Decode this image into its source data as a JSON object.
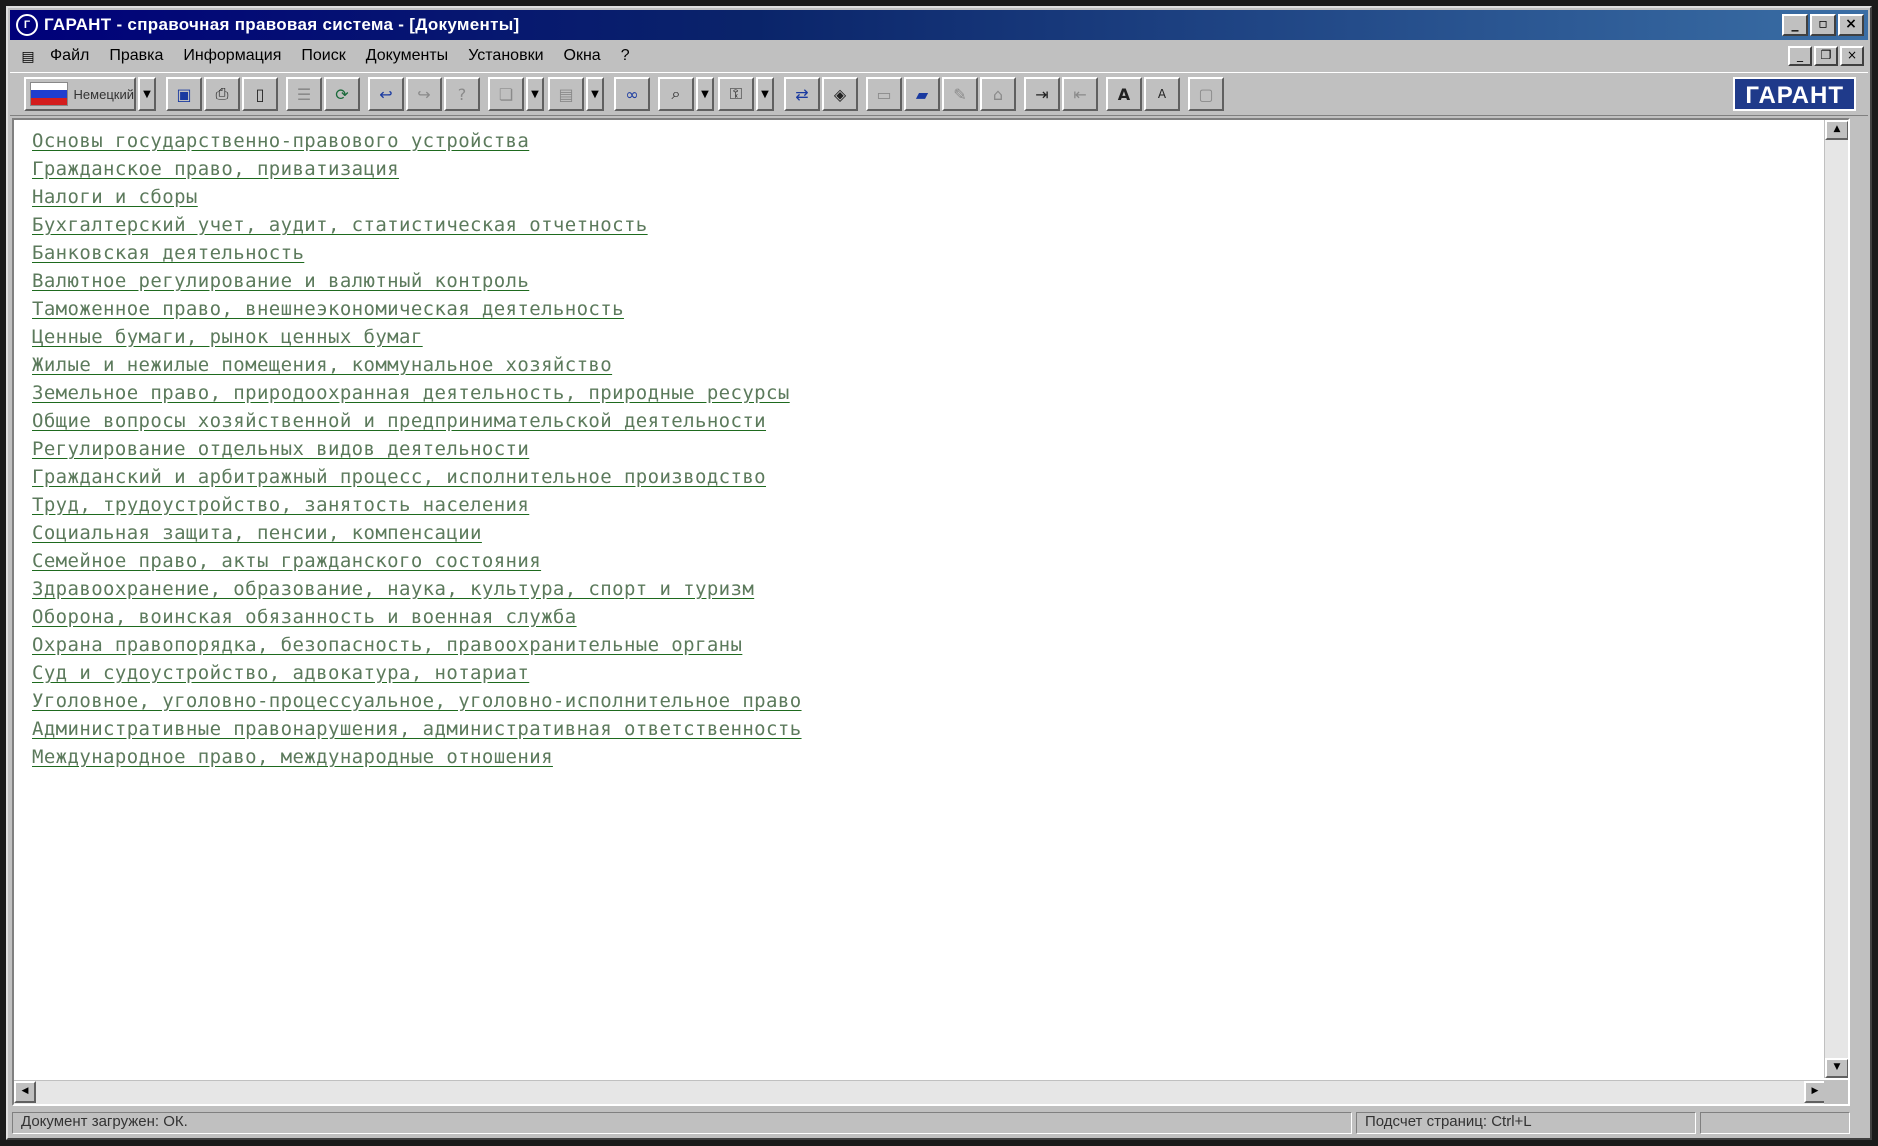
{
  "window": {
    "title": "ГАРАНТ - справочная правовая система - [Документы]",
    "controls": {
      "minimize": "_",
      "maximize": "▫",
      "close": "×"
    }
  },
  "menu": {
    "items": [
      "Файл",
      "Правка",
      "Информация",
      "Поиск",
      "Документы",
      "Установки",
      "Окна",
      "?"
    ]
  },
  "toolbar": {
    "language_label": "Немецкий",
    "logo_text": "ГАРАНТ",
    "icons": [
      "save-icon",
      "print-icon",
      "preview-icon",
      "list-icon",
      "refresh-icon",
      "back-icon",
      "forward-icon",
      "help-icon",
      "copy-icon",
      "paste-icon",
      "binoculars-icon",
      "search-icon",
      "key-icon",
      "comparison-icon",
      "bookmark-icon",
      "folder-icon",
      "notes-icon",
      "text-size-icon",
      "font-icon"
    ]
  },
  "documents": {
    "items": [
      "Основы государственно-правового устройства",
      "Гражданское право, приватизация",
      "Налоги и сборы",
      "Бухгалтерский учет, аудит, статистическая отчетность",
      "Банковская деятельность",
      "Валютное регулирование и валютный контроль",
      "Таможенное право, внешнеэкономическая деятельность",
      "Ценные бумаги, рынок ценных бумаг",
      "Жилые и нежилые помещения, коммунальное хозяйство",
      "Земельное право, природоохранная деятельность, природные ресурсы",
      "Общие вопросы хозяйственной и предпринимательской деятельности",
      "Регулирование отдельных видов деятельности",
      "Гражданский и арбитражный процесс, исполнительное производство",
      "Труд, трудоустройство, занятость населения",
      "Социальная защита, пенсии, компенсации",
      "Семейное право, акты гражданского состояния",
      "Здравоохранение, образование, наука, культура, спорт и туризм",
      "Оборона, воинская обязанность и военная служба",
      "Охрана правопорядка, безопасность, правоохранительные органы",
      "Суд и судоустройство, адвокатура, нотариат",
      "Уголовное, уголовно-процессуальное, уголовно-исполнительное право",
      "Административные правонарушения, административная ответственность",
      "Международное право, международные отношения"
    ]
  },
  "status": {
    "left": "Документ загружен: ОК.",
    "right": "Подсчет страниц: Ctrl+L"
  },
  "colors": {
    "titlebar": "#0a246a",
    "link": "#5c7a5c",
    "window_bg": "#c0c0c0"
  }
}
